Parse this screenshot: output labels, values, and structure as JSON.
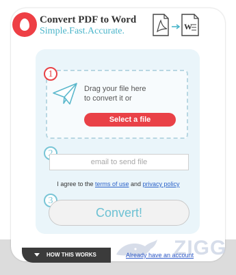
{
  "header": {
    "title": "Convert PDF to Word",
    "tagline": "Simple.Fast.Accurate.",
    "logo_icon": "flame-drop-icon",
    "conversion_icons": [
      "pdf-file-icon",
      "arrow-right-icon",
      "word-file-icon"
    ]
  },
  "steps": {
    "step1": {
      "number": "1",
      "instruction_line1": "Drag your file here",
      "instruction_line2": "to convert it or",
      "select_label": "Select a file"
    },
    "step2": {
      "number": "2",
      "email_placeholder": "email to send file"
    },
    "terms": {
      "prefix": "I agree to the ",
      "terms_link": "terms of use",
      "middle": " and ",
      "privacy_link": "privacy policy"
    },
    "step3": {
      "number": "3",
      "convert_label": "Convert!"
    }
  },
  "footer": {
    "how_label": "HOW THIS WORKS",
    "account_link": "Already have an account",
    "watermark": "ZIGG"
  },
  "colors": {
    "accent_red": "#e94147",
    "accent_teal": "#4bb5ca",
    "panel_bg": "#eaf5fa"
  }
}
